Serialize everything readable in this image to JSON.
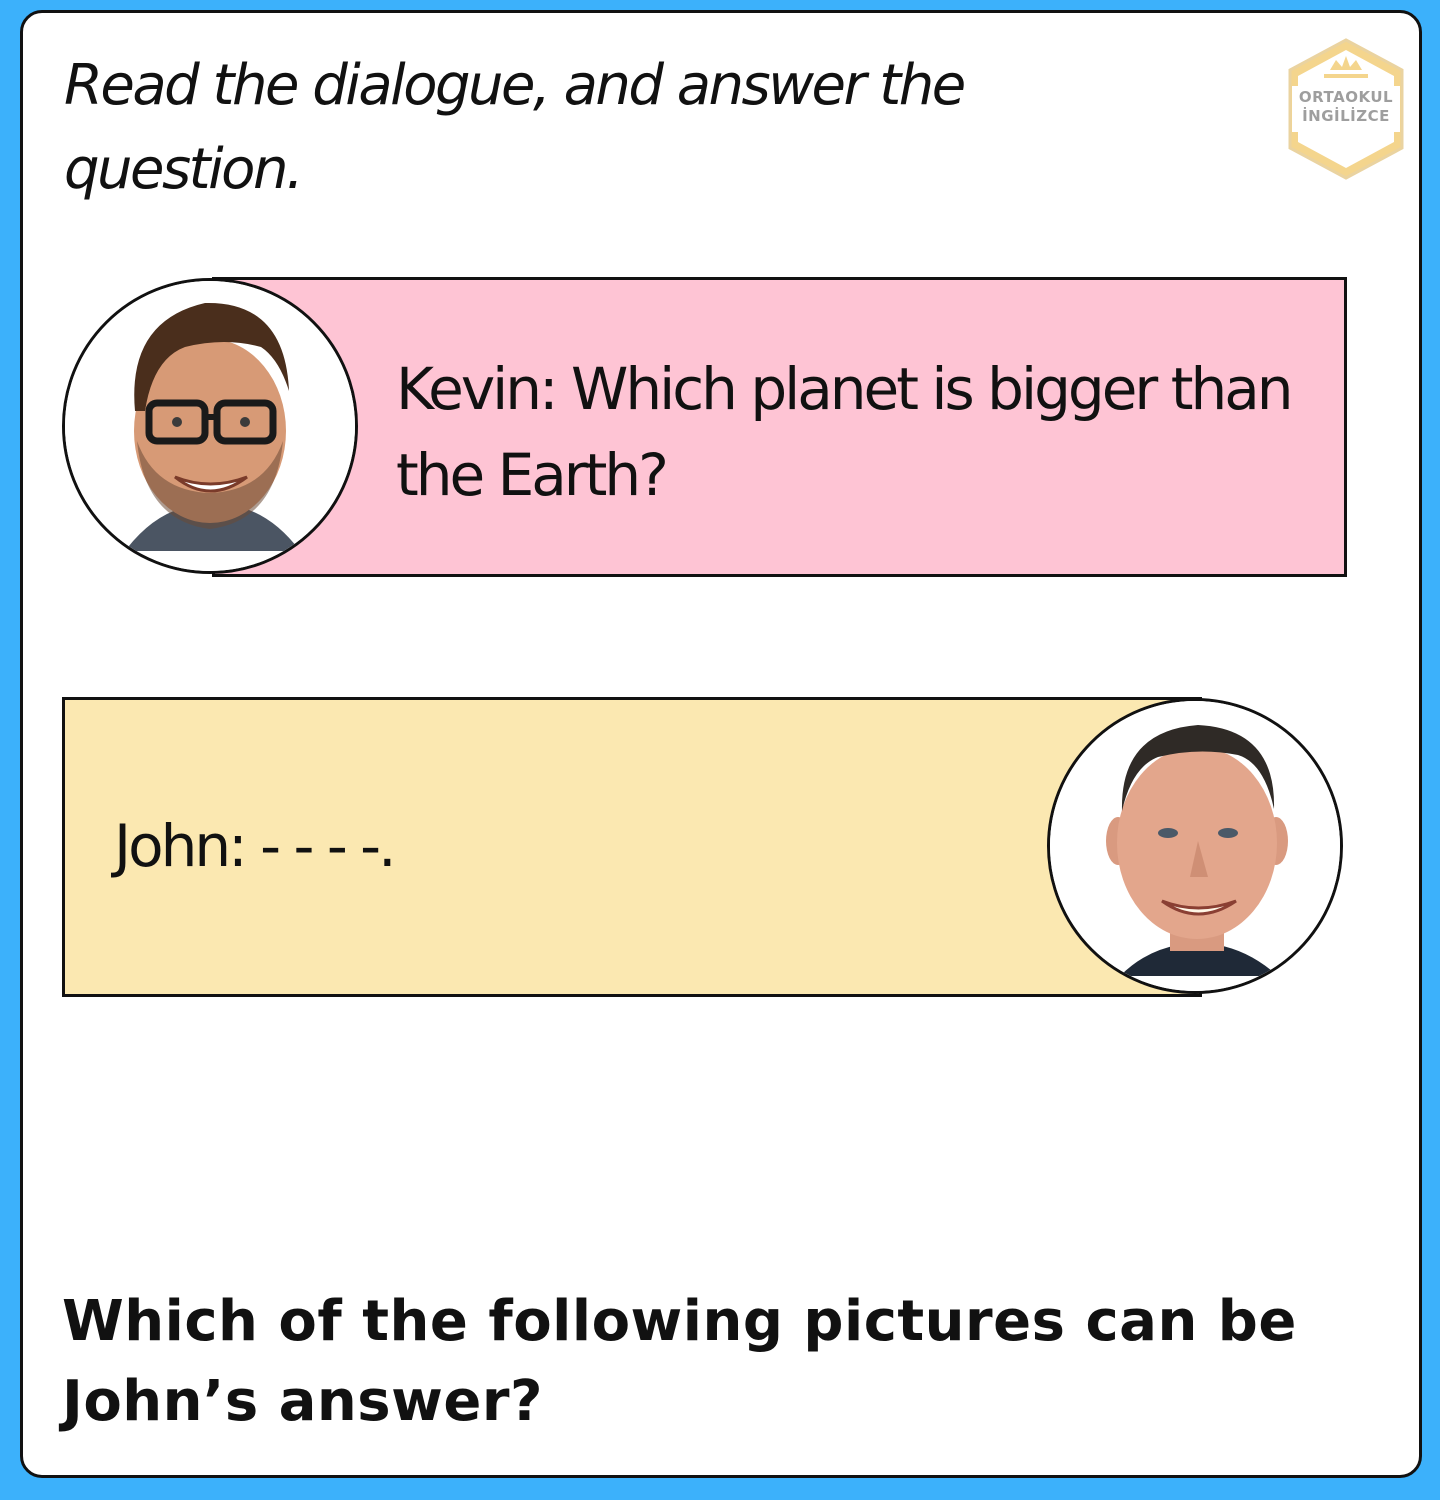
{
  "instruction": "Read the dialogue, and answer the question.",
  "logo": {
    "line1": "ORTAOKUL",
    "line2": "İNGİLİZCE",
    "colors": {
      "hexagon": "#f4d58d",
      "text": "#9e9e9e"
    }
  },
  "dialogue": [
    {
      "speaker": "Kevin",
      "text": "Kevin: Which planet is bigger than the Earth?",
      "bubble_color": "#fec4d4",
      "avatar": "man-with-glasses-photo"
    },
    {
      "speaker": "John",
      "text": "John: - - - -.",
      "bubble_color": "#fbe8b1",
      "avatar": "smiling-man-photo"
    }
  ],
  "question": "Which of the following pictures can be John’s answer?",
  "colors": {
    "page_border": "#3cb1fb",
    "card": "#ffffff",
    "text": "#111111"
  }
}
